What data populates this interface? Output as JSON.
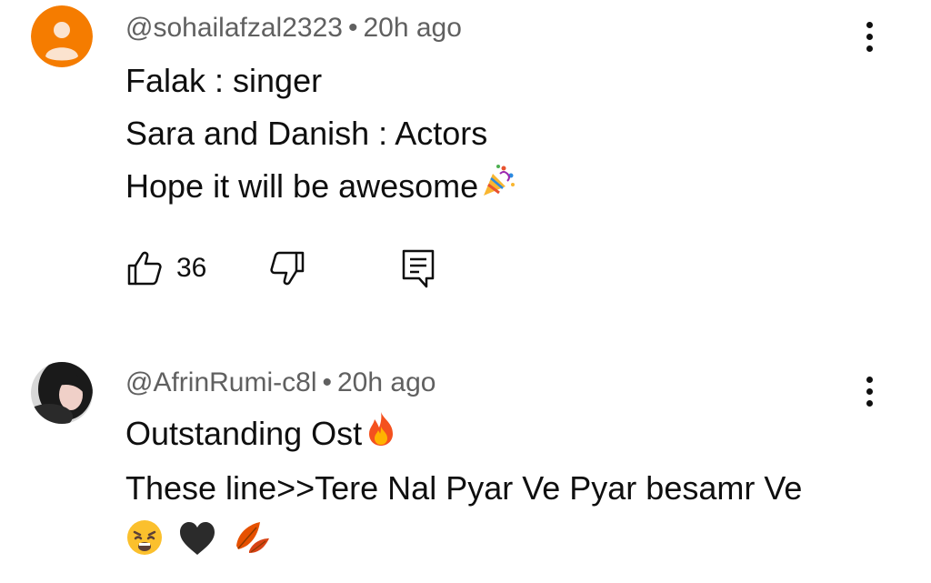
{
  "comments": [
    {
      "username": "@sohailafzal2323",
      "separator": "•",
      "time": "20h ago",
      "lines": [
        "Falak : singer",
        "Sara and Danish : Actors",
        "Hope it will be awesome"
      ],
      "likes": "36",
      "avatar_color": "#f57c00"
    },
    {
      "username": "@AfrinRumi-c8l",
      "separator": "•",
      "time": "20h ago",
      "lines": [
        "Outstanding Ost",
        "These line>>Tere Nal Pyar Ve Pyar besamr Ve"
      ]
    }
  ],
  "icons": {
    "like": "thumbs-up-icon",
    "dislike": "thumbs-down-icon",
    "reply": "reply-icon",
    "menu": "more-vertical-icon",
    "emojis": [
      "party-popper-emoji",
      "fire-emoji",
      "weary-face-emoji",
      "black-heart-emoji",
      "fallen-leaf-emoji"
    ]
  }
}
